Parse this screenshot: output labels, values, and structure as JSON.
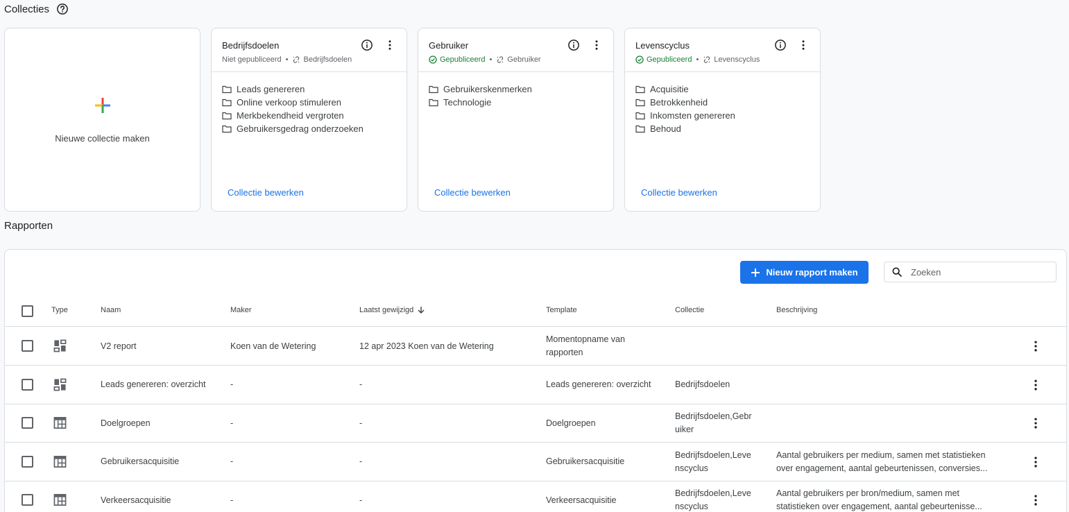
{
  "collections_section": {
    "title": "Collecties"
  },
  "new_collection": {
    "label": "Nieuwe collectie maken"
  },
  "collections": [
    {
      "title": "Bedrijfsdoelen",
      "status": "Niet gepubliceerd",
      "published": false,
      "link": "Bedrijfsdoelen",
      "folders": [
        "Leads genereren",
        "Online verkoop stimuleren",
        "Merkbekendheid vergroten",
        "Gebruikersgedrag onderzoeken"
      ],
      "edit_label": "Collectie bewerken"
    },
    {
      "title": "Gebruiker",
      "status": "Gepubliceerd",
      "published": true,
      "link": "Gebruiker",
      "folders": [
        "Gebruikerskenmerken",
        "Technologie"
      ],
      "edit_label": "Collectie bewerken"
    },
    {
      "title": "Levenscyclus",
      "status": "Gepubliceerd",
      "published": true,
      "link": "Levenscyclus",
      "folders": [
        "Acquisitie",
        "Betrokkenheid",
        "Inkomsten genereren",
        "Behoud"
      ],
      "edit_label": "Collectie bewerken"
    }
  ],
  "reports_section": {
    "title": "Rapporten"
  },
  "toolbar": {
    "new_report_label": "Nieuw rapport maken",
    "search_placeholder": "Zoeken"
  },
  "table": {
    "headers": {
      "type": "Type",
      "name": "Naam",
      "maker": "Maker",
      "modified": "Laatst gewijzigd",
      "template": "Template",
      "collection": "Collectie",
      "description": "Beschrijving"
    },
    "rows": [
      {
        "type": "dashboard",
        "name": "V2 report",
        "maker": "Koen van de Wetering",
        "modified": "12 apr 2023 Koen van de Wetering",
        "template": [
          "Momentopname van",
          "rapporten"
        ],
        "collection": [],
        "description": []
      },
      {
        "type": "dashboard",
        "name": "Leads genereren: overzicht",
        "maker": "-",
        "modified": "-",
        "template": [
          "Leads genereren: overzicht"
        ],
        "collection": [
          "Bedrijfsdoelen"
        ],
        "description": []
      },
      {
        "type": "table",
        "name": "Doelgroepen",
        "maker": "-",
        "modified": "-",
        "template": [
          "Doelgroepen"
        ],
        "collection": [
          "Bedrijfsdoelen,Gebr",
          "uiker"
        ],
        "description": []
      },
      {
        "type": "table",
        "name": "Gebruikersacquisitie",
        "maker": "-",
        "modified": "-",
        "template": [
          "Gebruikersacquisitie"
        ],
        "collection": [
          "Bedrijfsdoelen,Leve",
          "nscyclus"
        ],
        "description": [
          "Aantal gebruikers per medium, samen met statistieken",
          "over engagement, aantal gebeurtenissen, conversies..."
        ]
      },
      {
        "type": "table",
        "name": "Verkeersacquisitie",
        "maker": "-",
        "modified": "-",
        "template": [
          "Verkeersacquisitie"
        ],
        "collection": [
          "Bedrijfsdoelen,Leve",
          "nscyclus"
        ],
        "description": [
          "Aantal gebruikers per bron/medium, samen met",
          "statistieken over engagement, aantal gebeurtenisse..."
        ]
      }
    ]
  },
  "colors": {
    "accent": "#1a73e8",
    "published": "#188038",
    "border": "#dadce0",
    "background": "#f8f9fa"
  }
}
